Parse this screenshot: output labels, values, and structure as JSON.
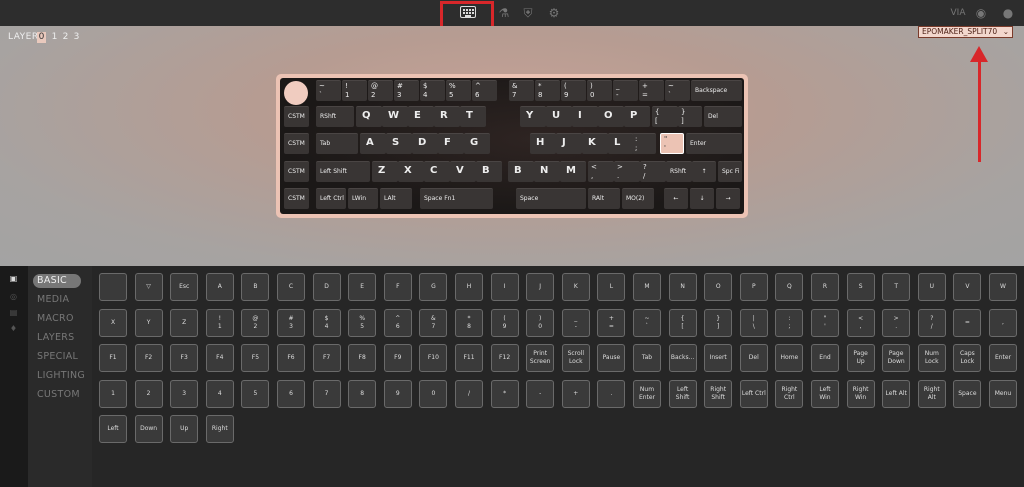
{
  "topbar": {
    "tabs": [
      {
        "name": "configure-tab",
        "icon": "keyboard-icon",
        "active": true
      },
      {
        "name": "test-tab",
        "icon": "beaker-icon"
      },
      {
        "name": "firmware-tab",
        "icon": "shield-icon"
      },
      {
        "name": "settings-tab",
        "icon": "gear-icon"
      }
    ],
    "right_icons": [
      "via-logo-icon",
      "discord-icon",
      "github-icon"
    ],
    "highlight_color": "#d8272a"
  },
  "layer": {
    "label": "LAYER",
    "options": [
      "0",
      "1",
      "2",
      "3"
    ],
    "selected": "0"
  },
  "device_select": {
    "value": "EPOMAKER_SPLIT70"
  },
  "keyboard": {
    "rows": [
      [
        {
          "t": "~",
          "b": "`"
        },
        {
          "t": "!",
          "b": "1"
        },
        {
          "t": "@",
          "b": "2"
        },
        {
          "t": "#",
          "b": "3"
        },
        {
          "t": "$",
          "b": "4"
        },
        {
          "t": "%",
          "b": "5"
        },
        {
          "t": "^",
          "b": "6"
        },
        {
          "t": "&",
          "b": "7"
        },
        {
          "t": "*",
          "b": "8"
        },
        {
          "t": "(",
          "b": "9"
        },
        {
          "t": ")",
          "b": "0"
        },
        {
          "t": "_",
          "b": "-"
        },
        {
          "t": "+",
          "b": "="
        },
        {
          "t": "~",
          "b": "`"
        },
        {
          "s": "Backspace"
        }
      ],
      [
        {
          "s": "CSTM"
        },
        {
          "s": "RShft"
        },
        {
          "L": "Q"
        },
        {
          "L": "W"
        },
        {
          "L": "E"
        },
        {
          "L": "R"
        },
        {
          "L": "T"
        },
        {
          "L": "Y"
        },
        {
          "L": "U"
        },
        {
          "L": "I"
        },
        {
          "L": "O"
        },
        {
          "L": "P"
        },
        {
          "t": "{",
          "b": "["
        },
        {
          "t": "}",
          "b": "]"
        },
        {
          "s": "Del"
        }
      ],
      [
        {
          "s": "CSTM"
        },
        {
          "s": "Tab"
        },
        {
          "L": "A"
        },
        {
          "L": "S"
        },
        {
          "L": "D"
        },
        {
          "L": "F"
        },
        {
          "L": "G"
        },
        {
          "L": "H"
        },
        {
          "L": "J"
        },
        {
          "L": "K"
        },
        {
          "L": "L"
        },
        {
          "t": ":",
          "b": ";"
        },
        {
          "t": "\"",
          "b": "'"
        },
        {
          "s": "Enter"
        }
      ],
      [
        {
          "s": "CSTM"
        },
        {
          "s": "Left Shift"
        },
        {
          "L": "Z"
        },
        {
          "L": "X"
        },
        {
          "L": "C"
        },
        {
          "L": "V"
        },
        {
          "L": "B"
        },
        {
          "L": "B"
        },
        {
          "L": "N"
        },
        {
          "L": "M"
        },
        {
          "t": "<",
          "b": ","
        },
        {
          "t": ">",
          "b": "."
        },
        {
          "t": "?",
          "b": "/"
        },
        {
          "s": "RShft"
        },
        {
          "c": "↑"
        },
        {
          "s": "Spc Fi"
        }
      ],
      [
        {
          "s": "CSTM"
        },
        {
          "s": "Left Ctrl"
        },
        {
          "s": "LWin"
        },
        {
          "s": "LAlt"
        },
        {
          "s": "Space Fn1"
        },
        {
          "s": "Space"
        },
        {
          "s": "RAlt"
        },
        {
          "s": "MO(2)"
        },
        {
          "c": "←"
        },
        {
          "c": "↓"
        },
        {
          "c": "→"
        }
      ]
    ]
  },
  "sidebar": {
    "icons": [
      "keycap-icon",
      "gauge-icon",
      "save-icon",
      "bulb-icon"
    ],
    "categories": [
      "BASIC",
      "MEDIA",
      "MACRO",
      "LAYERS",
      "SPECIAL",
      "LIGHTING",
      "CUSTOM"
    ],
    "active": "BASIC"
  },
  "keycodes": [
    [
      "",
      "▽",
      "Esc",
      "A",
      "B",
      "C",
      "D",
      "E",
      "F",
      "G",
      "H",
      "I",
      "J",
      "K",
      "L",
      "M",
      "N",
      "O",
      "P",
      "Q",
      "R",
      "S",
      "T",
      "U",
      "V",
      "W"
    ],
    [
      "X",
      "Y",
      "Z",
      "!\n1",
      "@\n2",
      "#\n3",
      "$\n4",
      "%\n5",
      "^\n6",
      "&\n7",
      "*\n8",
      "(\n9",
      ")\n0",
      "_\n-",
      "+\n=",
      "~\n`",
      "{\n[",
      "}\n]",
      "|\n\\",
      ":\n;",
      "\"\n'",
      "<\n,",
      ">\n.",
      "?\n/",
      "=",
      ","
    ],
    [
      "F1",
      "F2",
      "F3",
      "F4",
      "F5",
      "F6",
      "F7",
      "F8",
      "F9",
      "F10",
      "F11",
      "F12",
      "Print\nScreen",
      "Scroll\nLock",
      "Pause",
      "Tab",
      "Backs...",
      "Insert",
      "Del",
      "Home",
      "End",
      "Page\nUp",
      "Page\nDown",
      "Num\nLock",
      "Caps\nLock",
      "Enter"
    ],
    [
      "1",
      "2",
      "3",
      "4",
      "5",
      "6",
      "7",
      "8",
      "9",
      "0",
      "/",
      "*",
      "-",
      "+",
      ".",
      "Num\nEnter",
      "Left\nShift",
      "Right\nShift",
      "Left Ctrl",
      "Right\nCtrl",
      "Left\nWin",
      "Right\nWin",
      "Left Alt",
      "Right\nAlt",
      "Space",
      "Menu"
    ],
    [
      "Left",
      "Down",
      "Up",
      "Right"
    ]
  ]
}
